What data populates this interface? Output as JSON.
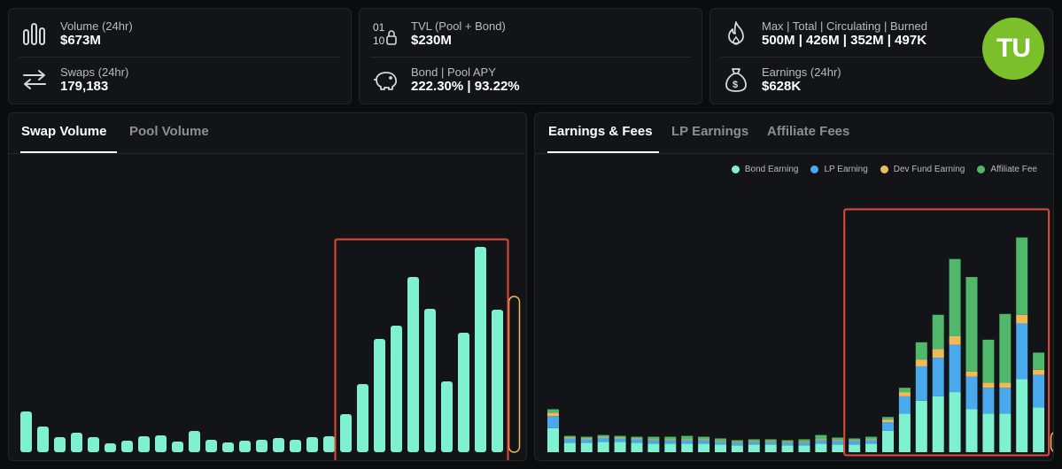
{
  "stats": {
    "volume": {
      "label": "Volume (24hr)",
      "value": "$673M"
    },
    "swaps": {
      "label": "Swaps (24hr)",
      "value": "179,183"
    },
    "tvl": {
      "label": "TVL (Pool + Bond)",
      "value": "$230M"
    },
    "apy": {
      "label": "Bond | Pool APY",
      "value": "222.30% | 93.22%"
    },
    "supply": {
      "label": "Max | Total | Circulating | Burned",
      "value": "500M | 426M | 352M | 497K"
    },
    "earnings": {
      "label": "Earnings (24hr)",
      "value": "$628K"
    }
  },
  "logo": {
    "text": "TU",
    "color": "#7bbf2a"
  },
  "left_panel": {
    "tabs": [
      "Swap Volume",
      "Pool Volume"
    ],
    "active_tab": 0
  },
  "right_panel": {
    "tabs": [
      "Earnings & Fees",
      "LP Earnings",
      "Affiliate Fees"
    ],
    "active_tab": 0
  },
  "colors": {
    "bond": "#7ef2d0",
    "lp": "#4aa8ec",
    "dev": "#f0b959",
    "affiliate": "#4fb86b",
    "highlight": "#e04b3a",
    "pending": "#f0b959"
  },
  "chart_data": [
    {
      "type": "bar",
      "title": "Swap Volume",
      "values": [
        46,
        29,
        17,
        22,
        17,
        10,
        13,
        18,
        19,
        12,
        24,
        14,
        11,
        13,
        14,
        16,
        14,
        17,
        18,
        43,
        77,
        128,
        143,
        198,
        162,
        80,
        135,
        232,
        161
      ],
      "ylim": [
        0,
        240
      ],
      "pending_last_bar": 176,
      "highlight_range": [
        19,
        28
      ]
    },
    {
      "type": "bar",
      "title": "Earnings & Fees",
      "legend": [
        "Bond Earning",
        "LP Earning",
        "Dev Fund Earning",
        "Affiliate Fee"
      ],
      "series": [
        {
          "name": "Bond Earning",
          "values": [
            28,
            11,
            11,
            12,
            12,
            11,
            10,
            10,
            10,
            10,
            9,
            8,
            9,
            9,
            8,
            8,
            10,
            9,
            9,
            10,
            25,
            45,
            60,
            65,
            70,
            50,
            45,
            45,
            85,
            52
          ]
        },
        {
          "name": "LP Earning",
          "values": [
            14,
            5,
            4,
            5,
            4,
            4,
            4,
            4,
            4,
            4,
            3,
            3,
            3,
            3,
            3,
            3,
            4,
            4,
            4,
            4,
            10,
            20,
            40,
            45,
            55,
            38,
            30,
            30,
            65,
            38
          ]
        },
        {
          "name": "Dev Fund Earning",
          "values": [
            4,
            1,
            1,
            1,
            1,
            1,
            1,
            1,
            1,
            1,
            1,
            1,
            1,
            1,
            1,
            1,
            1,
            1,
            1,
            1,
            3,
            5,
            8,
            10,
            10,
            6,
            6,
            6,
            10,
            6
          ]
        },
        {
          "name": "Affiliate Fee",
          "values": [
            4,
            2,
            2,
            2,
            2,
            2,
            3,
            3,
            4,
            3,
            3,
            2,
            2,
            2,
            2,
            3,
            5,
            3,
            2,
            3,
            3,
            5,
            20,
            40,
            90,
            110,
            50,
            80,
            90,
            20
          ]
        }
      ],
      "ylim": [
        0,
        270
      ],
      "highlight_range": [
        18,
        29
      ]
    }
  ]
}
